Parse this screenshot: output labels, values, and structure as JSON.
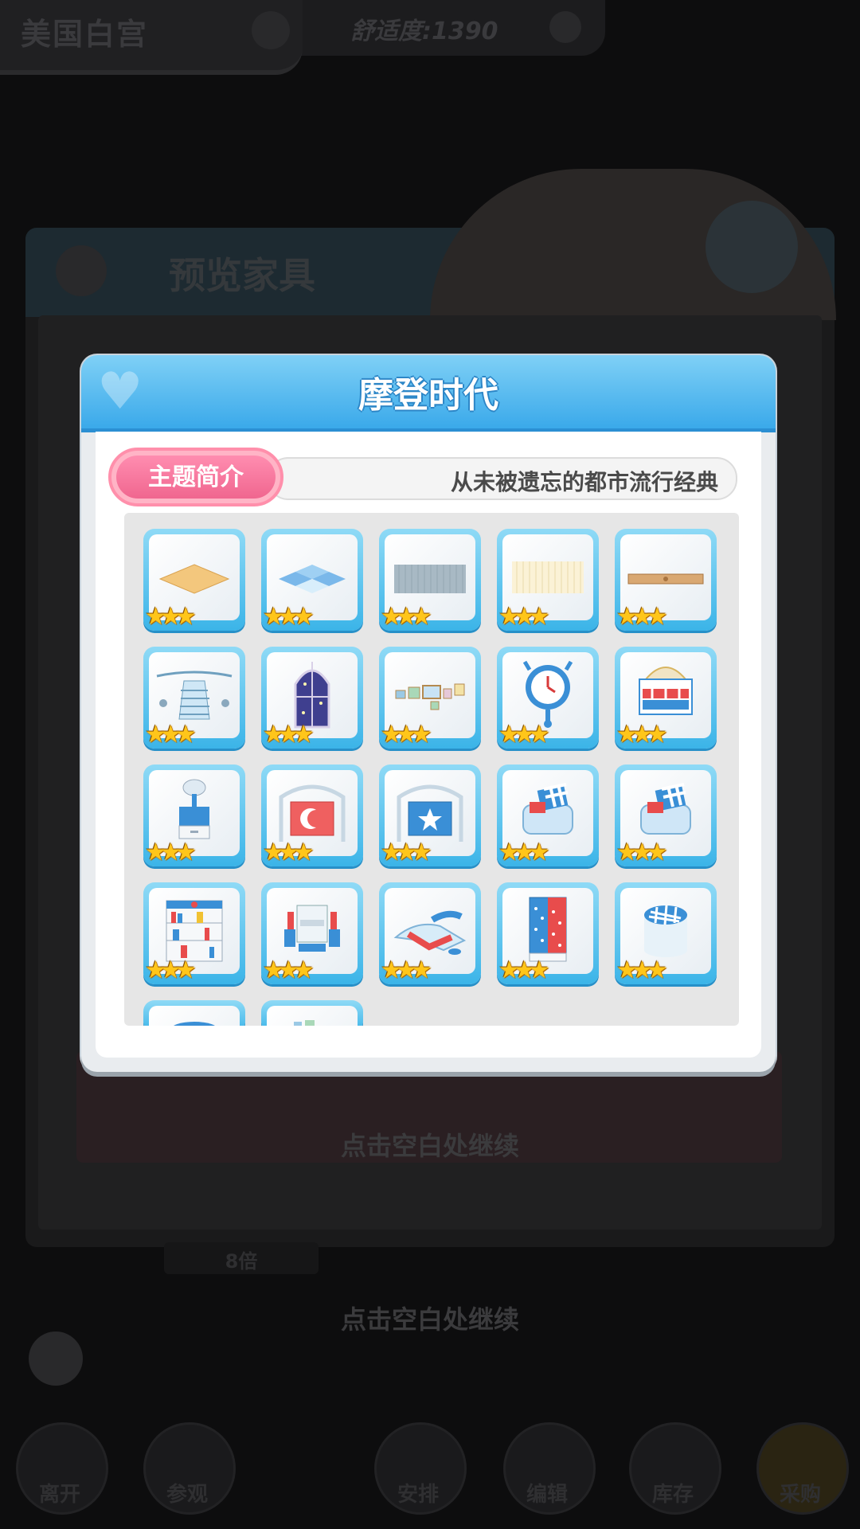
{
  "background": {
    "location": "美国白宫",
    "comfort": "舒适度:1390",
    "panel_title": "预览家具",
    "inner_continue": "点击空白处继续",
    "outer_continue": "点击空白处继续",
    "badge": "8倍",
    "nav": [
      {
        "label": "离开"
      },
      {
        "label": "参观"
      },
      {
        "label": "安排"
      },
      {
        "label": "编辑"
      },
      {
        "label": "库存"
      },
      {
        "label": "采购"
      }
    ]
  },
  "modal": {
    "title": "摩登时代",
    "theme_button": "主题简介",
    "theme_description": "从未被遗忘的都市流行经典"
  },
  "furniture": [
    {
      "name": "wood-floor",
      "stars": 3
    },
    {
      "name": "blue-tile-floor",
      "stars": 3
    },
    {
      "name": "gray-wall",
      "stars": 3
    },
    {
      "name": "cream-wall",
      "stars": 3
    },
    {
      "name": "wood-trim",
      "stars": 3
    },
    {
      "name": "staircase",
      "stars": 3
    },
    {
      "name": "night-window",
      "stars": 3
    },
    {
      "name": "picture-frames",
      "stars": 3
    },
    {
      "name": "alarm-clock",
      "stars": 3
    },
    {
      "name": "royal-bed",
      "stars": 3
    },
    {
      "name": "nightstand-lamp",
      "stars": 3
    },
    {
      "name": "moon-headboard",
      "stars": 3
    },
    {
      "name": "star-headboard",
      "stars": 3
    },
    {
      "name": "checkered-armchair",
      "stars": 3
    },
    {
      "name": "checkered-armchair-2",
      "stars": 3
    },
    {
      "name": "bookshelf",
      "stars": 3
    },
    {
      "name": "dining-set",
      "stars": 3
    },
    {
      "name": "lounge-chair",
      "stars": 3
    },
    {
      "name": "polka-wardrobe",
      "stars": 3
    },
    {
      "name": "checkered-ottoman",
      "stars": 3
    },
    {
      "name": "partial-item-1",
      "stars": 0
    },
    {
      "name": "partial-item-2",
      "stars": 0
    }
  ],
  "stars_glyph": "★★★"
}
